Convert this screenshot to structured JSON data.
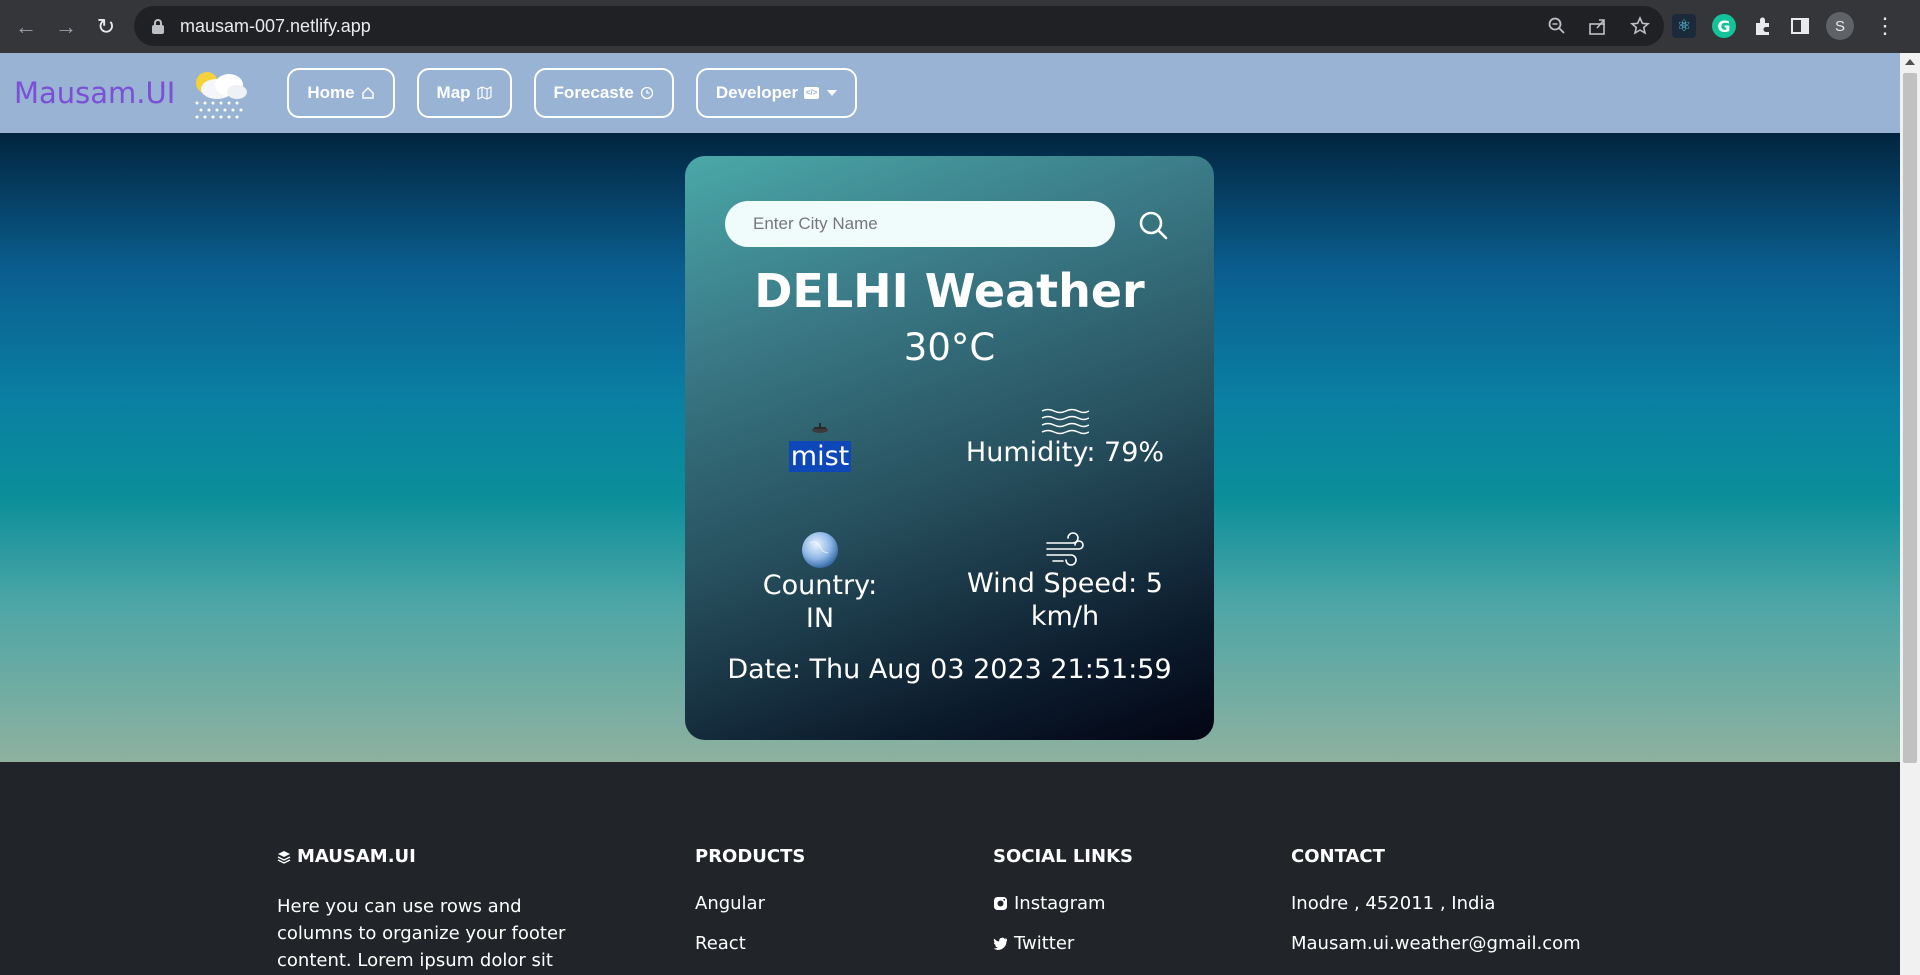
{
  "browser": {
    "url": "mausam-007.netlify.app",
    "profile_initial": "S"
  },
  "navbar": {
    "brand": "Mausam.UI",
    "links": [
      {
        "label": "Home",
        "icon": "home-icon"
      },
      {
        "label": "Map",
        "icon": "map-icon"
      },
      {
        "label": "Forecaste",
        "icon": "clock-icon"
      },
      {
        "label": "Developer",
        "icon": "code-icon",
        "dropdown": true
      }
    ]
  },
  "weather": {
    "search_placeholder": "Enter City Name",
    "title": "DELHI Weather",
    "temperature": "30°C",
    "condition": "mist",
    "humidity": "Humidity: 79%",
    "country": "Country: IN",
    "wind_line1": "Wind Speed: 5",
    "wind_line2": "km/h",
    "date": "Date: Thu Aug 03 2023 21:51:59"
  },
  "footer": {
    "brand": "MAUSAM.UI",
    "about": "Here you can use rows and columns to organize your footer content. Lorem ipsum dolor sit amet, consectetur",
    "products_title": "PRODUCTS",
    "products": [
      "Angular",
      "React"
    ],
    "social_title": "SOCIAL LINKS",
    "social": [
      {
        "label": "Instagram",
        "icon": "instagram-icon"
      },
      {
        "label": "Twitter",
        "icon": "twitter-icon"
      }
    ],
    "contact_title": "CONTACT",
    "contact": [
      "Inodre , 452011 , India",
      "Mausam.ui.weather@gmail.com"
    ]
  },
  "colors": {
    "navbar_bg": "#98b3d4",
    "brand": "#7b4fd6",
    "footer_bg": "#212529",
    "selection": "#0d47b8"
  }
}
